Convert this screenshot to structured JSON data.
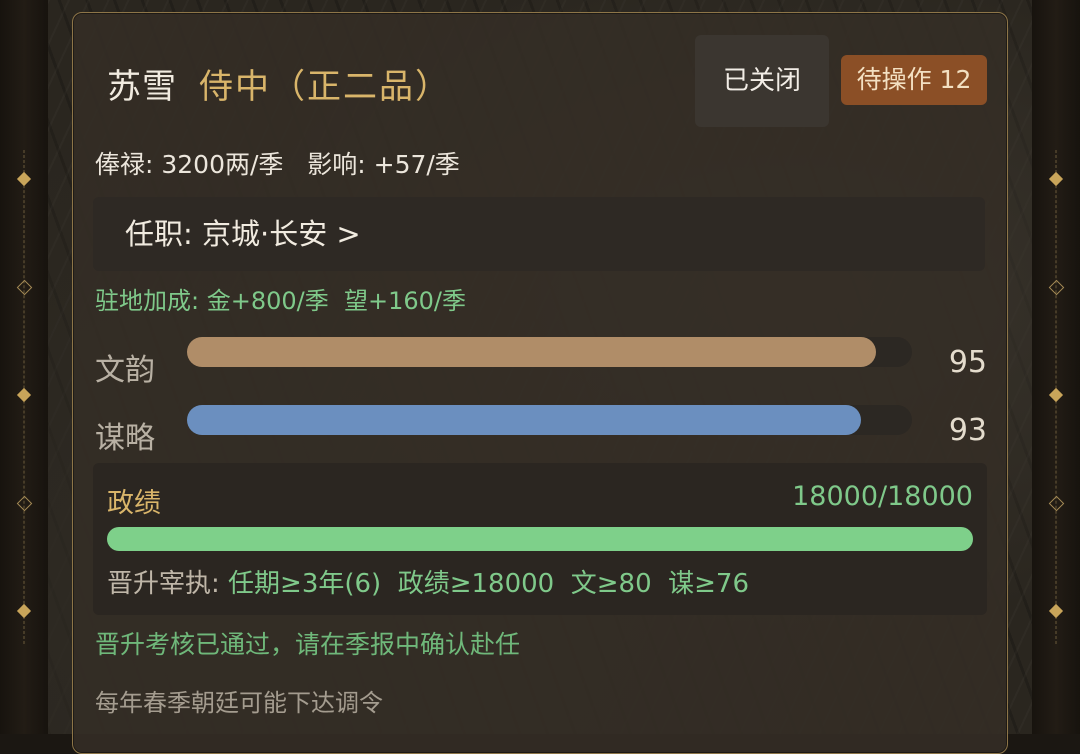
{
  "official": {
    "name": "苏雪",
    "rank": "侍中（正二品）"
  },
  "header": {
    "closed_label": "已关闭",
    "pending_label": "待操作 12"
  },
  "stats_line": "俸禄: 3200两/季   影响: +57/季",
  "post_line": "任职: 京城·长安  >",
  "bonus_line": "驻地加成: 金+800/季  望+160/季",
  "attributes": [
    {
      "label": "文韵",
      "value": "95",
      "fraction": 0.95,
      "color": "#b08d68"
    },
    {
      "label": "谋略",
      "value": "93",
      "fraction": 0.93,
      "color": "#6b8fbf"
    }
  ],
  "merit": {
    "label": "政绩",
    "value_text": "18000/18000",
    "fraction": 1.0,
    "promotion_label": "晋升宰执: ",
    "promotion_requirements": "任期≥3年(6)  政绩≥18000  文≥80  谋≥76"
  },
  "notice": "晋升考核已通过，请在季报中确认赴任",
  "hint": "每年春季朝廷可能下达调令",
  "colors": {
    "gold": "#d9b56a",
    "green": "#7fc98a",
    "badge": "#8b4f26"
  }
}
